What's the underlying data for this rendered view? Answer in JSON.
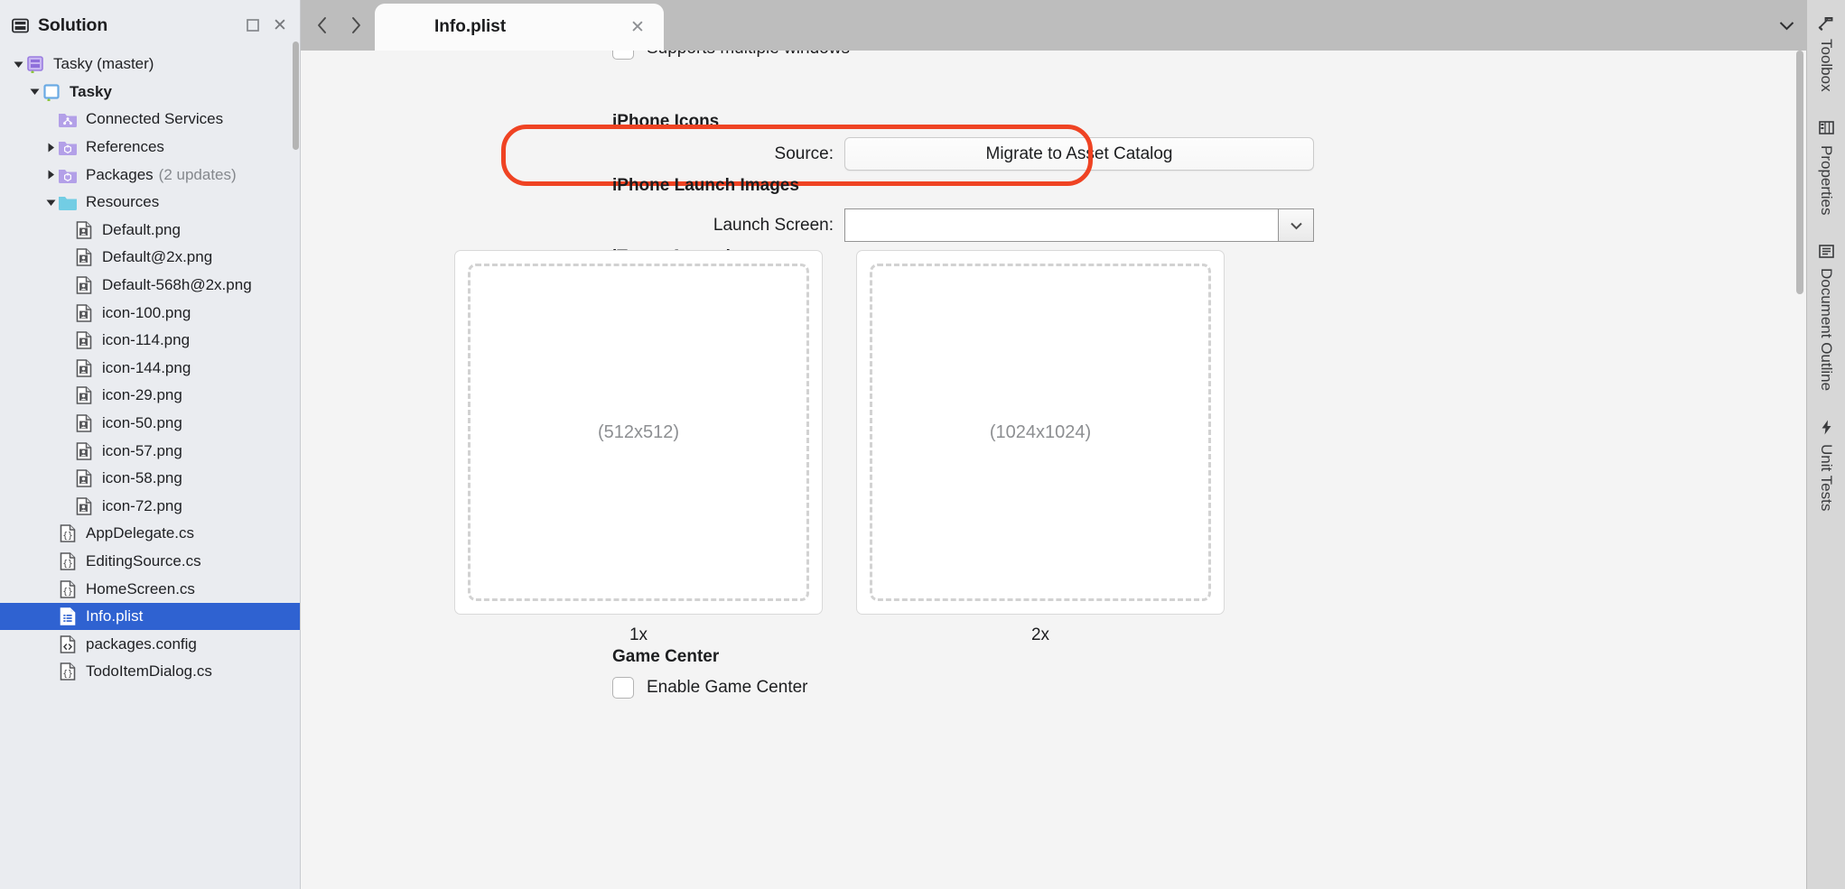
{
  "solution_pad": {
    "title": "Solution",
    "header_icon": "solution-icon",
    "pin_button": "pin-icon",
    "close_button": "close-icon",
    "tree": [
      {
        "label": "Tasky (master)",
        "indent": 0,
        "twisty": "down",
        "icon": "solution-file-icon",
        "bold": false,
        "selected": false
      },
      {
        "label": "Tasky",
        "indent": 1,
        "twisty": "down",
        "icon": "project-icon",
        "bold": true,
        "selected": false
      },
      {
        "label": "Connected Services",
        "indent": 2,
        "twisty": "none",
        "icon": "folder-services-icon",
        "bold": false,
        "selected": false
      },
      {
        "label": "References",
        "indent": 2,
        "twisty": "right",
        "icon": "folder-package-icon",
        "bold": false,
        "selected": false
      },
      {
        "label": "Packages",
        "sub": "(2 updates)",
        "indent": 2,
        "twisty": "right",
        "icon": "folder-package-icon",
        "bold": false,
        "selected": false
      },
      {
        "label": "Resources",
        "indent": 2,
        "twisty": "down",
        "icon": "folder-cyan-icon",
        "bold": false,
        "selected": false
      },
      {
        "label": "Default.png",
        "indent": 3,
        "twisty": "none",
        "icon": "image-file-icon",
        "bold": false,
        "selected": false
      },
      {
        "label": "Default@2x.png",
        "indent": 3,
        "twisty": "none",
        "icon": "image-file-icon",
        "bold": false,
        "selected": false
      },
      {
        "label": "Default-568h@2x.png",
        "indent": 3,
        "twisty": "none",
        "icon": "image-file-icon",
        "bold": false,
        "selected": false
      },
      {
        "label": "icon-100.png",
        "indent": 3,
        "twisty": "none",
        "icon": "image-file-icon",
        "bold": false,
        "selected": false
      },
      {
        "label": "icon-114.png",
        "indent": 3,
        "twisty": "none",
        "icon": "image-file-icon",
        "bold": false,
        "selected": false
      },
      {
        "label": "icon-144.png",
        "indent": 3,
        "twisty": "none",
        "icon": "image-file-icon",
        "bold": false,
        "selected": false
      },
      {
        "label": "icon-29.png",
        "indent": 3,
        "twisty": "none",
        "icon": "image-file-icon",
        "bold": false,
        "selected": false
      },
      {
        "label": "icon-50.png",
        "indent": 3,
        "twisty": "none",
        "icon": "image-file-icon",
        "bold": false,
        "selected": false
      },
      {
        "label": "icon-57.png",
        "indent": 3,
        "twisty": "none",
        "icon": "image-file-icon",
        "bold": false,
        "selected": false
      },
      {
        "label": "icon-58.png",
        "indent": 3,
        "twisty": "none",
        "icon": "image-file-icon",
        "bold": false,
        "selected": false
      },
      {
        "label": "icon-72.png",
        "indent": 3,
        "twisty": "none",
        "icon": "image-file-icon",
        "bold": false,
        "selected": false
      },
      {
        "label": "AppDelegate.cs",
        "indent": 2,
        "twisty": "none",
        "icon": "csharp-file-icon",
        "bold": false,
        "selected": false
      },
      {
        "label": "EditingSource.cs",
        "indent": 2,
        "twisty": "none",
        "icon": "csharp-file-icon",
        "bold": false,
        "selected": false
      },
      {
        "label": "HomeScreen.cs",
        "indent": 2,
        "twisty": "none",
        "icon": "csharp-file-icon",
        "bold": false,
        "selected": false
      },
      {
        "label": "Info.plist",
        "indent": 2,
        "twisty": "none",
        "icon": "plist-file-icon",
        "bold": false,
        "selected": true
      },
      {
        "label": "packages.config",
        "indent": 2,
        "twisty": "none",
        "icon": "xml-file-icon",
        "bold": false,
        "selected": false
      },
      {
        "label": "TodoItemDialog.cs",
        "indent": 2,
        "twisty": "none",
        "icon": "csharp-file-icon",
        "bold": false,
        "selected": false
      }
    ]
  },
  "tabbar": {
    "back_button": "chevron-left-icon",
    "forward_button": "chevron-right-icon",
    "tabs": [
      {
        "label": "Info.plist",
        "active": true,
        "close_button": "close-icon"
      }
    ],
    "overflow_button": "chevron-down-icon"
  },
  "editor": {
    "clipped_checkbox_label": "Supports multiple windows",
    "sections": {
      "iphone_icons": {
        "heading": "iPhone Icons",
        "source_label": "Source:",
        "source_button": "Migrate to Asset Catalog"
      },
      "iphone_launch_images": {
        "heading": "iPhone Launch Images",
        "launch_screen_label": "Launch Screen:",
        "launch_screen_value": "",
        "dropdown_button": "chevron-down-icon"
      },
      "itunes_artwork": {
        "heading": "iTunes Artwork",
        "dropzones": [
          {
            "placeholder": "(512x512)",
            "scale": "1x"
          },
          {
            "placeholder": "(1024x1024)",
            "scale": "2x"
          }
        ]
      },
      "game_center": {
        "heading": "Game Center",
        "enable_label": "Enable Game Center",
        "enable_checked": false
      }
    }
  },
  "annotation": {
    "color": "#ef4323",
    "target": "source-migrate-to-asset-catalog-row"
  },
  "right_rail": [
    {
      "label": "Toolbox",
      "icon": "toolbox-hammer-icon"
    },
    {
      "label": "Properties",
      "icon": "properties-grid-icon"
    },
    {
      "label": "Document Outline",
      "icon": "document-outline-icon"
    },
    {
      "label": "Unit Tests",
      "icon": "unit-tests-bolt-icon"
    }
  ]
}
